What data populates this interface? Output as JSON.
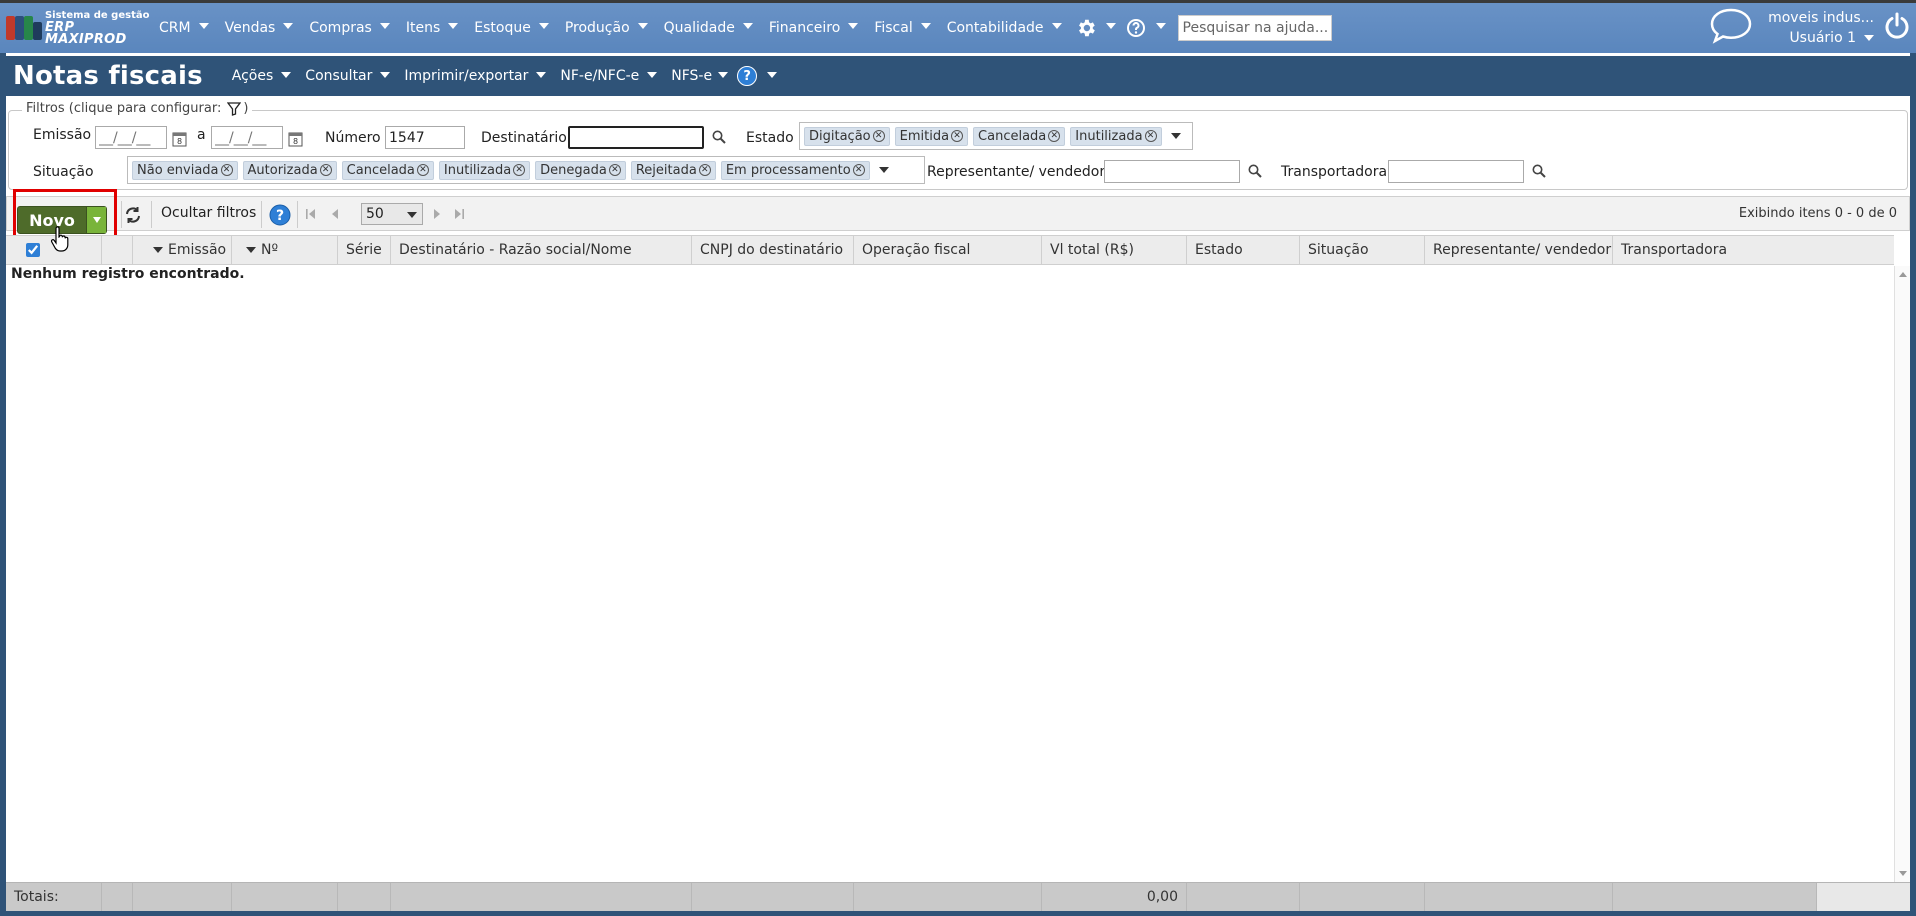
{
  "logo": {
    "line1": "Sistema de gestão",
    "line2": "ERP MAXIPROD"
  },
  "nav": [
    {
      "label": "CRM"
    },
    {
      "label": "Vendas"
    },
    {
      "label": "Compras"
    },
    {
      "label": "Itens"
    },
    {
      "label": "Estoque"
    },
    {
      "label": "Produção"
    },
    {
      "label": "Qualidade"
    },
    {
      "label": "Financeiro"
    },
    {
      "label": "Fiscal"
    },
    {
      "label": "Contabilidade"
    }
  ],
  "help_search": {
    "placeholder": "Pesquisar na ajuda..."
  },
  "user": {
    "company": "moveis indus...",
    "name": "Usuário 1"
  },
  "page": {
    "title": "Notas fiscais",
    "menus": [
      {
        "label": "Ações"
      },
      {
        "label": "Consultar"
      },
      {
        "label": "Imprimir/exportar"
      },
      {
        "label": "NF-e/NFC-e"
      },
      {
        "label": "NFS-e"
      }
    ],
    "help": "?"
  },
  "filters": {
    "legend": "Filtros (clique para configurar:",
    "legend_close": ")",
    "emissao_label": "Emissão",
    "date_placeholder": "__/__/__",
    "a_label": "a",
    "numero_label": "Número",
    "numero_value": "1547",
    "destinatario_label": "Destinatário",
    "destinatario_value": "",
    "estado_label": "Estado",
    "estado_tags": [
      {
        "label": "Digitação"
      },
      {
        "label": "Emitida"
      },
      {
        "label": "Cancelada"
      },
      {
        "label": "Inutilizada"
      }
    ],
    "situacao_label": "Situação",
    "situacao_tags": [
      {
        "label": "Não enviada"
      },
      {
        "label": "Autorizada"
      },
      {
        "label": "Cancelada"
      },
      {
        "label": "Inutilizada"
      },
      {
        "label": "Denegada"
      },
      {
        "label": "Rejeitada"
      },
      {
        "label": "Em processamento"
      }
    ],
    "representante_label": "Representante/ vendedor",
    "transportadora_label": "Transportadora"
  },
  "toolbar": {
    "novo_label": "Novo",
    "hide_filters_label": "Ocultar filtros",
    "page_size": "50",
    "showing": "Exibindo itens 0 - 0 de 0"
  },
  "grid": {
    "columns": [
      {
        "label": "Emissão",
        "sorted": true
      },
      {
        "label": "Nº",
        "sorted": true
      },
      {
        "label": "Série"
      },
      {
        "label": "Destinatário - Razão social/Nome"
      },
      {
        "label": "CNPJ do destinatário"
      },
      {
        "label": "Operação fiscal"
      },
      {
        "label": "Vl total (R$)"
      },
      {
        "label": "Estado"
      },
      {
        "label": "Situação"
      },
      {
        "label": "Representante/ vendedor"
      },
      {
        "label": "Transportadora"
      }
    ],
    "empty_message": "Nenhum registro encontrado.",
    "totals_label": "Totais:",
    "totals_value": "0,00"
  },
  "colors": {
    "topbar": "#5e8ac0",
    "titlebar": "#2f5378",
    "novo": "#4e6b2a",
    "highlight": "#e00000"
  }
}
